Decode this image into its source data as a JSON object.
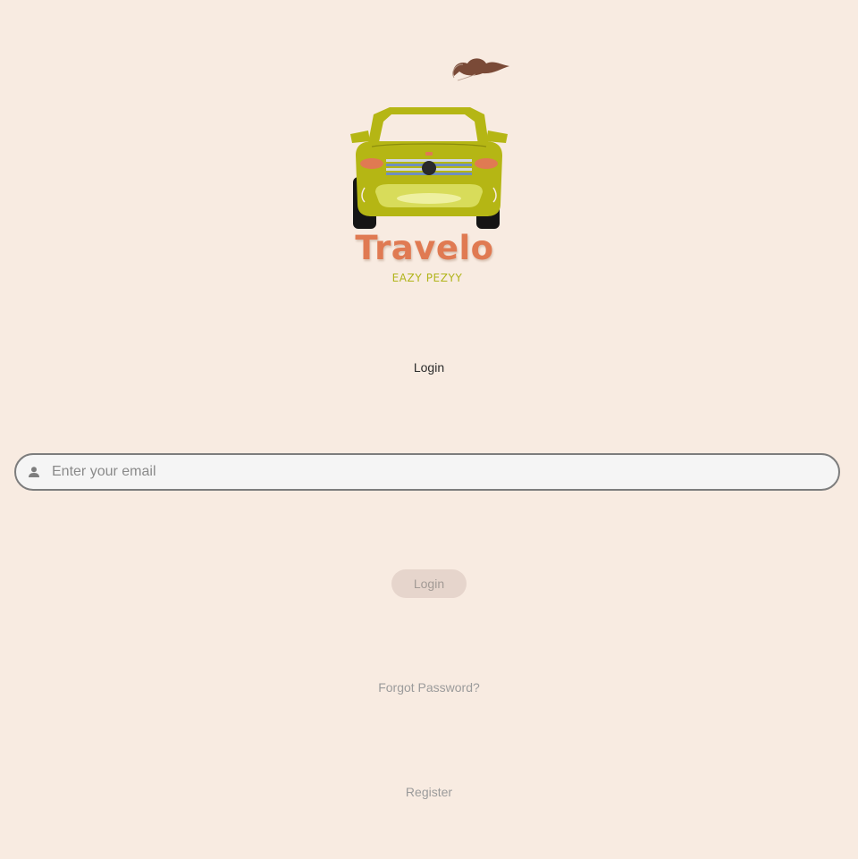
{
  "logo": {
    "brand_name": "Travelo",
    "tagline": "EAZY PEZYY",
    "car_icon": "car-rear-icon",
    "dust_icon": "smoke-puff-icon"
  },
  "login": {
    "heading": "Login",
    "email": {
      "placeholder": "Enter your email",
      "value": "",
      "icon": "person-icon"
    },
    "button_label": "Login",
    "forgot_password_label": "Forgot Password?",
    "register_label": "Register"
  },
  "colors": {
    "background": "#f8ebe1",
    "brand_orange": "#e07a52",
    "brand_olive": "#b1b41a",
    "button_bg": "#e6d5cc",
    "link_gray": "#9b9b9b"
  }
}
